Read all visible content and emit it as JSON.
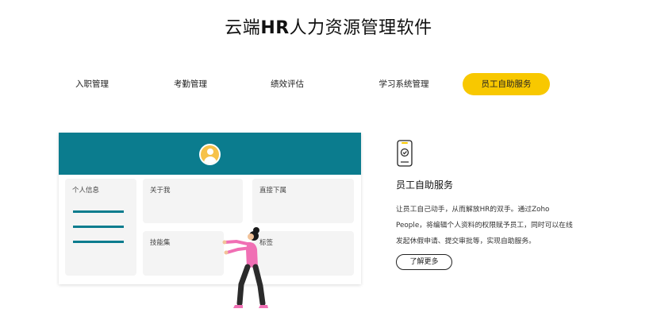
{
  "page": {
    "title_prefix": "云端",
    "title_bold": "HR",
    "title_suffix": "人力资源管理软件"
  },
  "tabs": [
    {
      "label": "入职管理",
      "active": false
    },
    {
      "label": "考勤管理",
      "active": false
    },
    {
      "label": "绩效评估",
      "active": false
    },
    {
      "label": "学习系统管理",
      "active": false
    },
    {
      "label": "员工自助服务",
      "active": true
    }
  ],
  "mockup": {
    "cards": {
      "personal_info": "个人信息",
      "about_me": "关于我",
      "direct_reports": "直接下属",
      "skills": "技能集",
      "tags": "标签"
    }
  },
  "feature": {
    "title": "员工自助服务",
    "description": "让员工自己动手，从而解放HR的双手。通过Zoho People，将编辑个人资料的权限赋予员工，同时可以在线发起休假申请、提交审批等，实现自助服务。",
    "button_label": "了解更多"
  },
  "colors": {
    "accent_yellow": "#f8c800",
    "teal": "#0b7c8e",
    "figure_pink": "#f06fb4"
  }
}
